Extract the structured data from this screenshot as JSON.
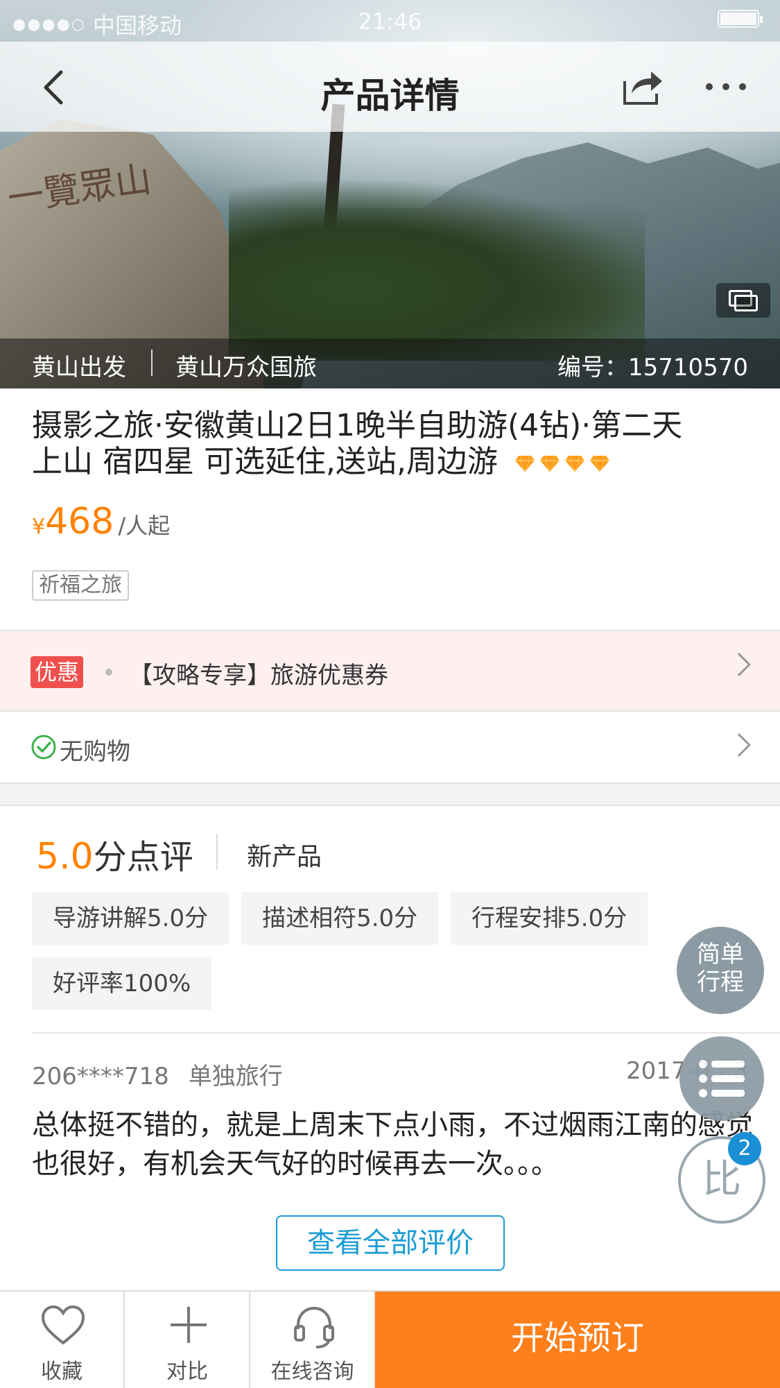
{
  "status_bar": {
    "carrier": "中国移动",
    "time": "21:46",
    "battery_level": 1.0
  },
  "nav": {
    "title": "产品详情"
  },
  "hero": {
    "departure": "黄山出发",
    "agency": "黄山万众国旅",
    "code": "编号：15710570",
    "carving": "一覽眾山"
  },
  "product": {
    "title_line1": "摄影之旅·安徽黄山2日1晚半自助游(4钻)·第二天",
    "title_line2": "上山 宿四星 可选延住,送站,周边游",
    "diamond_count": 4,
    "price_currency": "¥",
    "price_value": "468",
    "price_unit": "/人起",
    "tag": "祈福之旅"
  },
  "promo": {
    "badge": "优惠",
    "text": "【攻略专享】旅游优惠券"
  },
  "no_shopping": {
    "text": "无购物"
  },
  "rating": {
    "score": "5.0",
    "suffix": "分点评",
    "new_label": "新产品",
    "chips": [
      "导游讲解5.0分",
      "描述相符5.0分",
      "行程安排5.0分",
      "好评率100%"
    ]
  },
  "review": {
    "user": "206****718",
    "mode": "单独旅行",
    "date": "2017-0…3",
    "text": "总体挺不错的，就是上周末下点小雨，不过烟雨江南的感觉也很好，有机会天气好的时候再去一次。。。"
  },
  "view_all": "查看全部评价",
  "floating": {
    "simple_itinerary": "简单行程",
    "compare": "比",
    "compare_count": "2"
  },
  "bottom_bar": {
    "favorite": "收藏",
    "compare": "对比",
    "consult": "在线咨询",
    "book": "开始预订"
  },
  "colors": {
    "accent_orange": "#ff8200",
    "link_blue": "#1a9cd6",
    "promo_red": "#f0504d"
  },
  "icons": [
    "back-icon",
    "share-icon",
    "more-icon",
    "gallery-icon",
    "diamond-icon",
    "chevron-right-icon",
    "check-circle-icon",
    "list-icon",
    "heart-icon",
    "plus-icon",
    "headset-icon"
  ]
}
